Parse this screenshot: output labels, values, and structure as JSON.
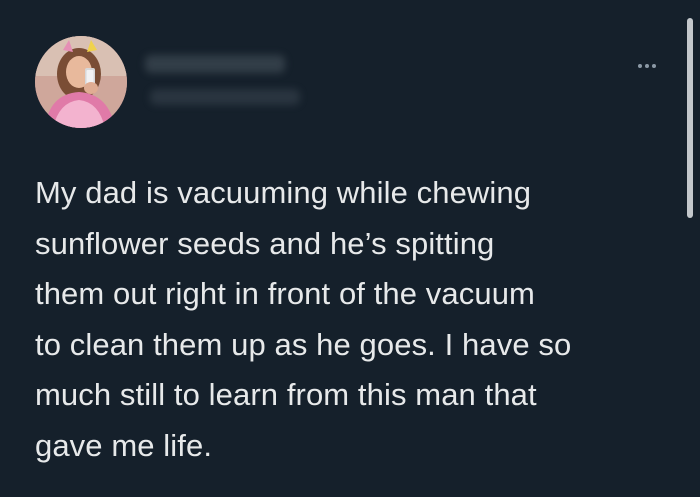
{
  "tweet": {
    "text": "My dad is vacuuming while chewing\nsunflower seeds and he’s spitting\nthem out right in front of the vacuum\nto clean them up as he goes. I have so\nmuch still to learn from this man that\ngave me life.",
    "more_icon": "ellipsis-icon"
  },
  "colors": {
    "background": "#15202b",
    "text": "#e7e9ea",
    "icon": "#8b98a5"
  }
}
